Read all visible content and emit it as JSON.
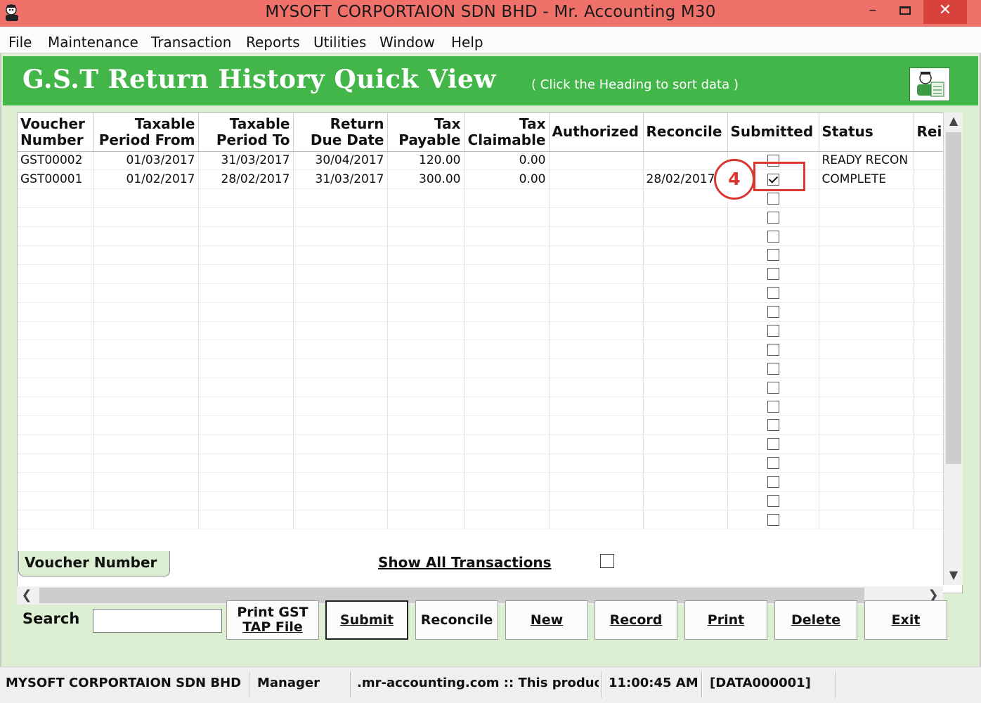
{
  "window": {
    "title": "MYSOFT CORPORTAION SDN BHD - Mr. Accounting M30",
    "minimize": "–",
    "close": "✕"
  },
  "menu": [
    "File",
    "Maintenance",
    "Transaction",
    "Reports",
    "Utilities",
    "Window",
    "Help"
  ],
  "banner": {
    "heading": "G.S.T Return History Quick View",
    "hint": "( Click the Heading to sort data )"
  },
  "columns": [
    {
      "line1": "Voucher",
      "line2": "Number"
    },
    {
      "line1": "Taxable",
      "line2": "Period From"
    },
    {
      "line1": "Taxable",
      "line2": "Period To"
    },
    {
      "line1": "Return",
      "line2": "Due Date"
    },
    {
      "line1": "Tax",
      "line2": "Payable"
    },
    {
      "line1": "Tax",
      "line2": "Claimable"
    },
    {
      "line1": "Authorized",
      "line2": ""
    },
    {
      "line1": "Reconcile",
      "line2": ""
    },
    {
      "line1": "Submitted",
      "line2": ""
    },
    {
      "line1": "Status",
      "line2": ""
    },
    {
      "line1": "Rei",
      "line2": ""
    }
  ],
  "rows": [
    {
      "voucher": "GST00002",
      "from": "01/03/2017",
      "to": "31/03/2017",
      "due": "30/04/2017",
      "payable": "120.00",
      "claimable": "0.00",
      "authorized": "",
      "reconcile": "",
      "submitted": false,
      "status": "READY RECON"
    },
    {
      "voucher": "GST00001",
      "from": "01/02/2017",
      "to": "28/02/2017",
      "due": "31/03/2017",
      "payable": "300.00",
      "claimable": "0.00",
      "authorized": "",
      "reconcile": "28/02/2017",
      "submitted": true,
      "status": "COMPLETE"
    }
  ],
  "sort_tab": "Voucher Number",
  "show_all": {
    "label": "Show All Transactions",
    "checked": false
  },
  "search": {
    "label": "Search",
    "value": ""
  },
  "buttons": {
    "print_gst_line1": "Print GST",
    "print_gst_line2": "TAP File",
    "submit": "Submit",
    "reconcile": "Reconcile",
    "new": "New",
    "record": "Record",
    "print": "Print",
    "delete": "Delete",
    "exit": "Exit"
  },
  "statusbar": {
    "company": "MYSOFT CORPORTAION SDN BHD",
    "user": "Manager",
    "site": ".mr-accounting.com :: This produc",
    "time": "11:00:45 AM",
    "data": "[DATA000001]"
  },
  "annotation": {
    "step": "4"
  },
  "colors": {
    "banner": "#43b649",
    "titlebar": "#f0706a",
    "client": "#dcefd2",
    "annotation": "#d9372f"
  }
}
